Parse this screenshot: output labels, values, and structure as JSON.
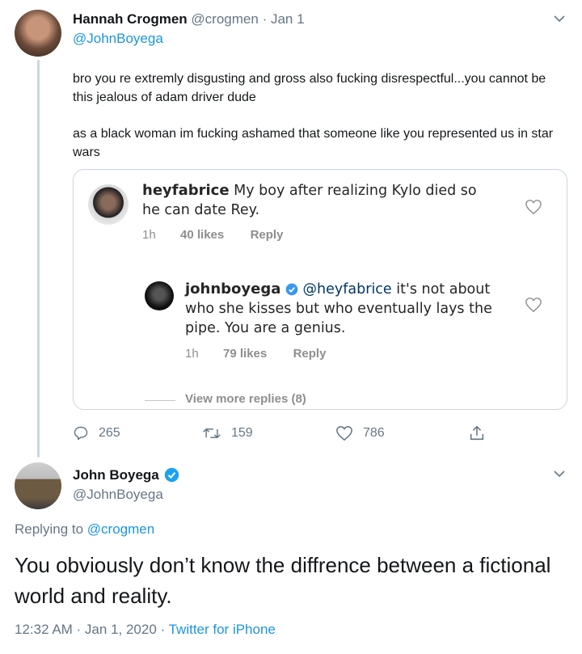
{
  "tweet1": {
    "author_name": "Hannah Crogmen",
    "author_handle": "@crogmen",
    "separator": "·",
    "date": "Jan 1",
    "reply_to": "@JohnBoyega",
    "paragraph1": "bro you re extremly disgusting and gross also fucking disrespectful...you cannot be this jealous of adam driver dude",
    "paragraph2": "as a black woman im fucking ashamed that someone like you represented us in star wars",
    "actions": {
      "replies": "265",
      "retweets": "159",
      "likes": "786"
    }
  },
  "embed": {
    "comment1": {
      "username": "heyfabrice",
      "text": "My boy after realizing Kylo died so he can date Rey.",
      "time": "1h",
      "likes": "40 likes",
      "reply_label": "Reply"
    },
    "comment2": {
      "username": "johnboyega",
      "mention": "@heyfabrice",
      "text": "it's not about who she kisses but who eventually lays the pipe. You are a genius.",
      "time": "1h",
      "likes": "79 likes",
      "reply_label": "Reply"
    },
    "view_more": "View more replies (8)"
  },
  "tweet2": {
    "author_name": "John Boyega",
    "author_handle": "@JohnBoyega",
    "replying_prefix": "Replying to",
    "replying_handle": "@crogmen",
    "text": "You obviously don’t know the diffrence between a fictional world and reality.",
    "timestamp": "12:32 AM · Jan 1, 2020 ·",
    "source": "Twitter for iPhone"
  },
  "colors": {
    "twitter_blue": "#1b95e0",
    "muted_gray": "#657786",
    "border": "#ccd6dd"
  },
  "icons": [
    "chevron-down-icon",
    "verified-icon",
    "heart-icon",
    "reply-icon",
    "retweet-icon",
    "like-icon",
    "share-icon"
  ]
}
